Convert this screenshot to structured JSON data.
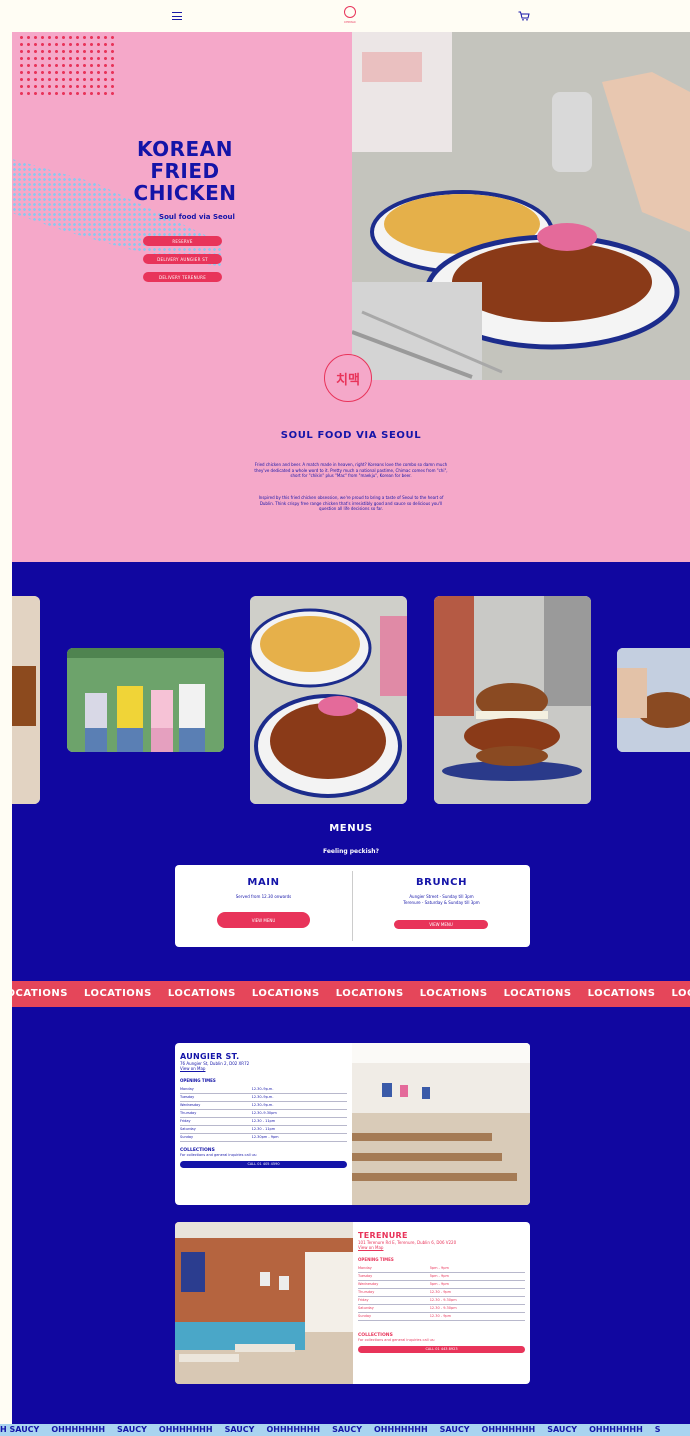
{
  "header": {
    "logo_text": "CHIMAC"
  },
  "hero": {
    "title_lines": [
      "KOREAN",
      "FRIED",
      "CHICKEN"
    ],
    "subtitle": "Soul food via Seoul",
    "buttons": [
      "RESERVE",
      "DELIVERY AUNGIER ST",
      "DELIVERY TERENURE"
    ],
    "stamp_text": "치맥"
  },
  "about": {
    "title": "SOUL FOOD VIA SEOUL",
    "paragraph1": "Fried chicken and beer. A match made in heaven, right? Koreans love the combo so damn much they've dedicated a whole word to it. Pretty much a national pastime, Chimac comes from \"chi\", short for \"chikin\" plus \"Mac\" from \"maekju\", Korean for beer.",
    "paragraph2": "Inspired by this fried chicken obsession, we're proud to bring a taste of Seoul to the heart of Dublin. Think crispy free range chicken that's irresistibly good and sauce so delicious you'll question all life decisions so far."
  },
  "menus": {
    "title": "MENUS",
    "subtitle": "Feeling peckish?",
    "main": {
      "title": "MAIN",
      "line": "Served from 12.30 onwards",
      "button": "VIEW MENU"
    },
    "brunch": {
      "title": "BRUNCH",
      "line1": "Aungier Street - Sunday till 3pm",
      "line2": "Terenure - Saturday & Sunday till 3pm",
      "button": "VIEW MENU"
    }
  },
  "ticker": {
    "word": "LOCATIONS"
  },
  "aungier": {
    "name": "AUNGIER ST.",
    "address": "76 Aungier St, Dublin 2, D02 XR72",
    "map_link": "View on Map",
    "hours_title": "OPENING TIMES",
    "hours": [
      {
        "day": "Monday",
        "time": "12.30–9p.m."
      },
      {
        "day": "Tuesday",
        "time": "12.30–9p.m."
      },
      {
        "day": "Wednesday",
        "time": "12.30–9p.m."
      },
      {
        "day": "Thursday",
        "time": "12.30–9.30pm"
      },
      {
        "day": "Friday",
        "time": "12.30 - 11pm"
      },
      {
        "day": "Saturday",
        "time": "12.30 - 11pm"
      },
      {
        "day": "Sunday",
        "time": "12.30pm - 9pm"
      }
    ],
    "collections_title": "COLLECTIONS",
    "collections_text": "For collections and general inquiries call us:",
    "call": "CALL 01 405 4590"
  },
  "terenure": {
    "name": "TERENURE",
    "address": "101 Terenure Rd E, Terenure, Dublin 6, D06 V220",
    "map_link": "View on Map",
    "hours_title": "OPENING TIMES",
    "hours": [
      {
        "day": "Monday",
        "time": "5pm - 9pm"
      },
      {
        "day": "Tuesday",
        "time": "5pm - 9pm"
      },
      {
        "day": "Wednesday",
        "time": "5pm - 9pm"
      },
      {
        "day": "Thursday",
        "time": "12.30 - 9pm"
      },
      {
        "day": "Friday",
        "time": "12.30 - 9.30pm"
      },
      {
        "day": "Saturday",
        "time": "12.30 - 9.30pm"
      },
      {
        "day": "Sunday",
        "time": "12.30 - 9pm"
      }
    ],
    "collections_title": "COLLECTIONS",
    "collections_text": "For collections and general inquiries call us:",
    "call": "CALL 01 443 8923"
  },
  "footer_ticker": {
    "words": [
      "H SAUCY",
      "OHHHHHHH",
      "SAUCY",
      "OHHHHHHH",
      "SAUCY",
      "OHHHHHHH",
      "SAUCY",
      "OHHHHHHH",
      "SAUCY",
      "OHHHHHHH",
      "SAUCY",
      "OHHHHHHH",
      "S"
    ]
  },
  "colors": {
    "pink": "#f5a8c9",
    "blue": "#1107a0",
    "red": "#e8345a",
    "light_blue": "#a9d4f0",
    "cream": "#fffdf4"
  }
}
